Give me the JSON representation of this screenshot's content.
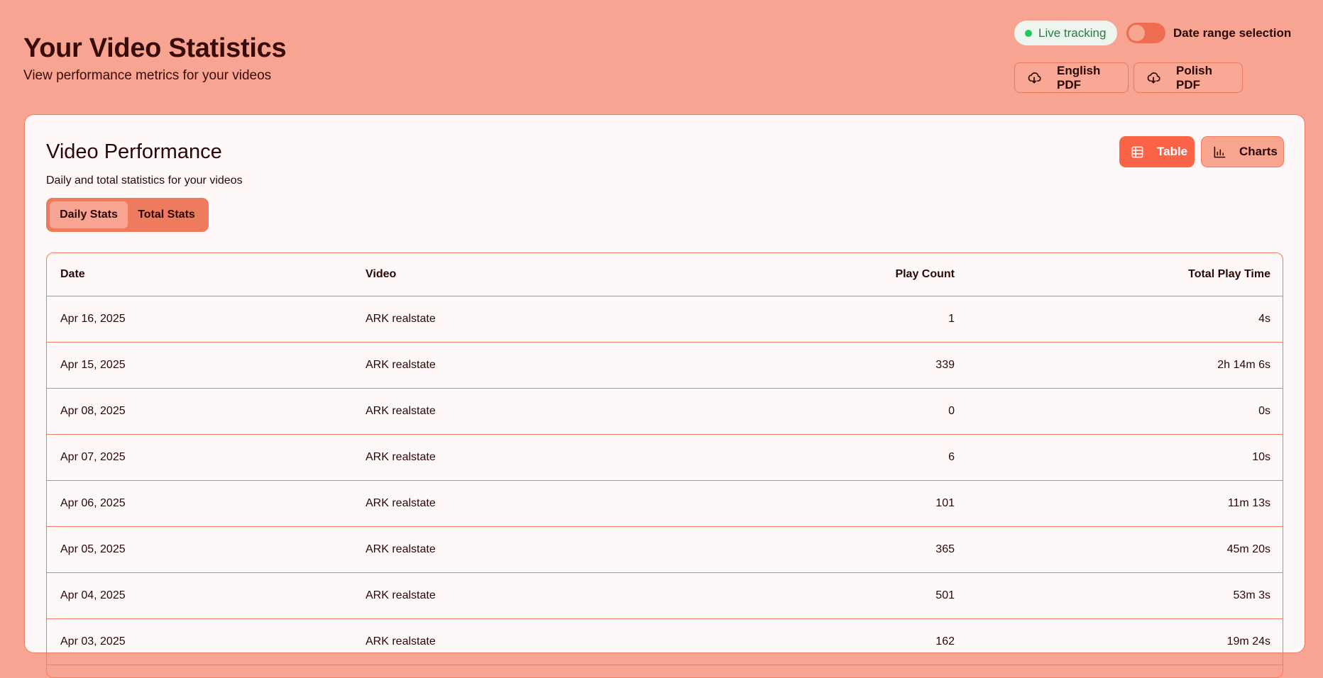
{
  "header": {
    "title": "Your Video Statistics",
    "subtitle": "View performance metrics for your videos"
  },
  "controls": {
    "live_label": "Live tracking",
    "date_range_label": "Date range selection",
    "date_range_enabled": false,
    "english_pdf_label": "English PDF",
    "polish_pdf_label": "Polish PDF"
  },
  "card": {
    "title": "Video Performance",
    "description": "Daily and total statistics for your videos",
    "view_table_label": "Table",
    "view_charts_label": "Charts",
    "active_view": "Table",
    "tabs": [
      {
        "label": "Daily Stats",
        "active": true
      },
      {
        "label": "Total Stats",
        "active": false
      }
    ]
  },
  "table": {
    "columns": [
      "Date",
      "Video",
      "Play Count",
      "Total Play Time"
    ],
    "rows": [
      {
        "date": "Apr 16, 2025",
        "video": "ARK realstate",
        "plays": "1",
        "time": "4s"
      },
      {
        "date": "Apr 15, 2025",
        "video": "ARK realstate",
        "plays": "339",
        "time": "2h 14m 6s"
      },
      {
        "date": "Apr 08, 2025",
        "video": "ARK realstate",
        "plays": "0",
        "time": "0s"
      },
      {
        "date": "Apr 07, 2025",
        "video": "ARK realstate",
        "plays": "6",
        "time": "10s"
      },
      {
        "date": "Apr 06, 2025",
        "video": "ARK realstate",
        "plays": "101",
        "time": "11m 13s"
      },
      {
        "date": "Apr 05, 2025",
        "video": "ARK realstate",
        "plays": "365",
        "time": "45m 20s"
      },
      {
        "date": "Apr 04, 2025",
        "video": "ARK realstate",
        "plays": "501",
        "time": "53m 3s"
      },
      {
        "date": "Apr 03, 2025",
        "video": "ARK realstate",
        "plays": "162",
        "time": "19m 24s"
      }
    ]
  },
  "colors": {
    "background": "#f7a492",
    "accent": "#fb6346",
    "live_dot": "#22c55e"
  },
  "icons": {
    "pdf": "cloud-download-icon",
    "table": "table-grid-icon",
    "charts": "bar-chart-icon"
  }
}
